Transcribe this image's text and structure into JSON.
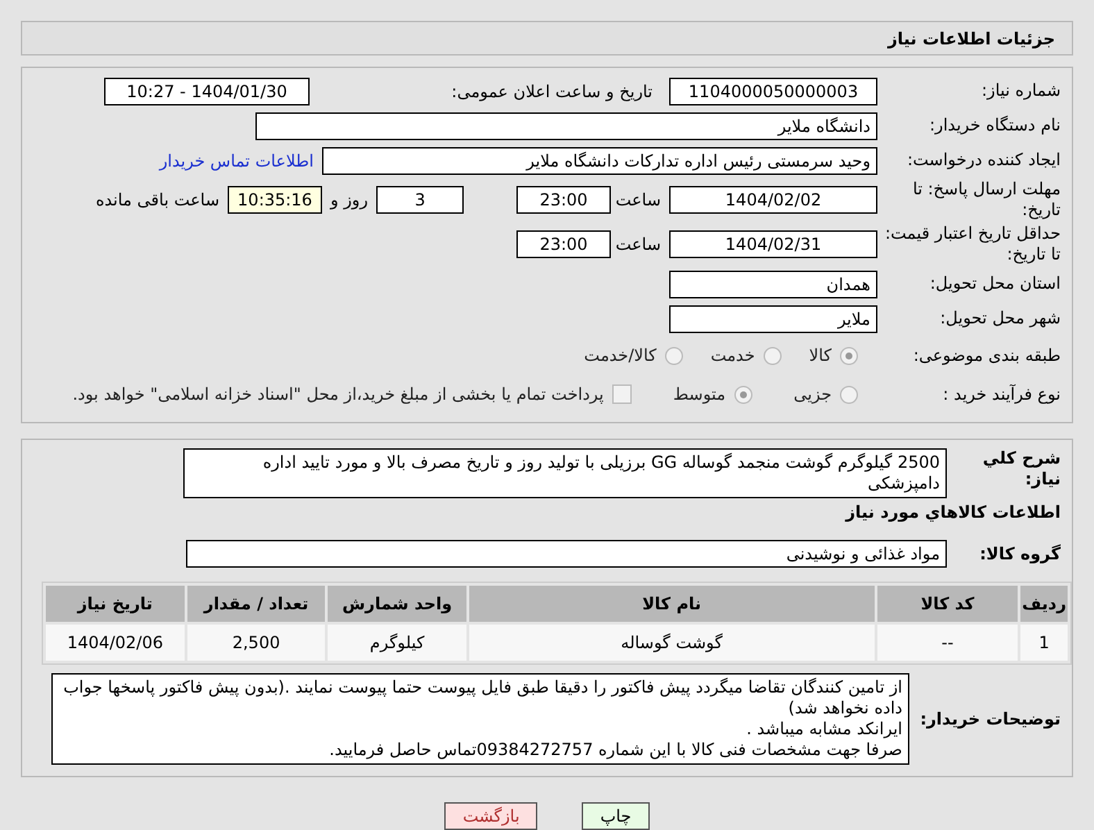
{
  "header": {
    "title": "جزئیات اطلاعات نیاز"
  },
  "details": {
    "need_number": {
      "label": "شماره نیاز:",
      "value": "1104000050000003"
    },
    "announce": {
      "label": "تاریخ و ساعت اعلان عمومی:",
      "value": "1404/01/30 - 10:27"
    },
    "buyer": {
      "label": "نام دستگاه خریدار:",
      "value": "دانشگاه ملایر"
    },
    "creator": {
      "label": "ایجاد کننده درخواست:",
      "value": "وحید سرمستی رئیس اداره تدارکات دانشگاه ملایر",
      "link": "اطلاعات تماس خریدار"
    },
    "deadline": {
      "label": "مهلت ارسال پاسخ: تا تاریخ:",
      "date": "1404/02/02",
      "time_label": "ساعت",
      "time": "23:00",
      "days": "3",
      "days_label": "روز و",
      "remaining": "10:35:16",
      "remaining_label": "ساعت باقی مانده"
    },
    "validity": {
      "label": "حداقل تاریخ اعتبار قیمت: تا تاریخ:",
      "date": "1404/02/31",
      "time_label": "ساعت",
      "time": "23:00"
    },
    "province": {
      "label": "استان محل تحویل:",
      "value": "همدان"
    },
    "city": {
      "label": "شهر محل تحویل:",
      "value": "ملایر"
    },
    "category": {
      "label": "طبقه بندی موضوعی:",
      "options": [
        {
          "label": "کالا",
          "selected": true,
          "disabled": true
        },
        {
          "label": "خدمت",
          "selected": false,
          "disabled": true
        },
        {
          "label": "کالا/خدمت",
          "selected": false,
          "disabled": true
        }
      ]
    },
    "process": {
      "label": "نوع فرآیند خرید :",
      "options": [
        {
          "label": "جزیی",
          "selected": false,
          "disabled": true
        },
        {
          "label": "متوسط",
          "selected": true,
          "disabled": true
        }
      ],
      "treasury": {
        "label": "پرداخت تمام یا بخشی از مبلغ خرید،از محل \"اسناد خزانه اسلامی\" خواهد بود.",
        "checked": false,
        "disabled": true
      }
    }
  },
  "goods": {
    "description": {
      "label": "شرح کلي نياز:",
      "value": "2500 گیلوگرم گوشت منجمد گوساله GG برزیلی با تولید روز و تاریخ مصرف بالا و مورد تایید اداره دامپزشکی"
    },
    "section_title": "اطلاعات کالاهاي مورد نياز",
    "group": {
      "label": "گروه کالا:",
      "value": "مواد غذائی و نوشیدنی"
    },
    "table": {
      "columns": [
        "ردیف",
        "کد کالا",
        "نام کالا",
        "واحد شمارش",
        "تعداد / مقدار",
        "تاریخ نیاز"
      ],
      "rows": [
        [
          "1",
          "--",
          "گوشت گوساله",
          "کیلوگرم",
          "2,500",
          "1404/02/06"
        ]
      ]
    },
    "notes": {
      "label": "توضیحات خریدار:",
      "lines": [
        "از تامین کنندگان تقاضا میگردد پیش فاکتور را دقیقا طبق فایل پیوست حتما پیوست نمایند .(بدون پیش فاکتور پاسخها جواب داده نخواهد شد)",
        "ایرانکد مشابه میباشد .",
        "صرفا جهت مشخصات فنی کالا با این شماره 09384272757تماس حاصل فرمایید."
      ]
    }
  },
  "buttons": [
    {
      "label": "چاپ",
      "kind": "print"
    },
    {
      "label": "بازگشت",
      "kind": "back"
    }
  ]
}
